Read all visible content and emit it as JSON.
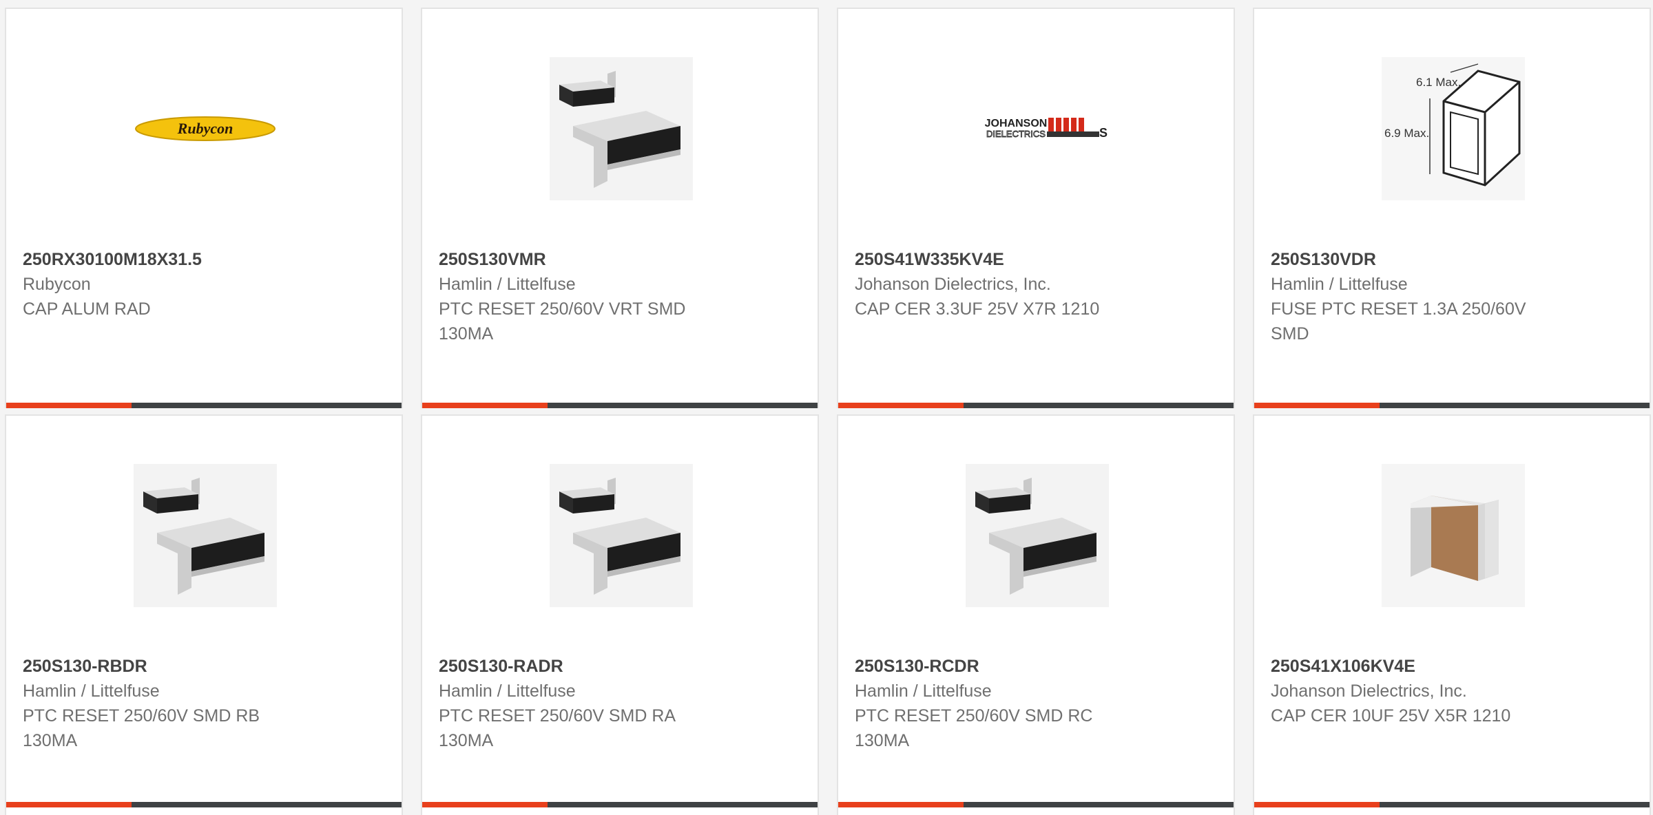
{
  "accent_color": "#e8401c",
  "bar_color": "#3f4244",
  "products": [
    {
      "part": "250RX30100M18X31.5",
      "manufacturer": "Rubycon",
      "description": "CAP ALUM RAD",
      "image": "rubycon-logo",
      "logo_text": "Rubycon"
    },
    {
      "part": "250S130VMR",
      "manufacturer": "Hamlin / Littelfuse",
      "description": "PTC RESET 250/60V VRT SMD 130MA",
      "image": "ptc-fuse-photo"
    },
    {
      "part": "250S41W335KV4E",
      "manufacturer": "Johanson Dielectrics, Inc.",
      "description": "CAP CER 3.3UF 25V X7R 1210",
      "image": "johanson-logo",
      "logo_text_1": "JOHANSON",
      "logo_text_2": "DIELECTRICS"
    },
    {
      "part": "250S130VDR",
      "manufacturer": "Hamlin / Littelfuse",
      "description": "FUSE PTC RESET 1.3A 250/60V SMD",
      "image": "fuse-dimension-drawing",
      "dim_1": "6.1 Max.",
      "dim_2": "6.9 Max."
    },
    {
      "part": "250S130-RBDR",
      "manufacturer": "Hamlin / Littelfuse",
      "description": "PTC RESET 250/60V SMD RB 130MA",
      "image": "ptc-fuse-photo"
    },
    {
      "part": "250S130-RADR",
      "manufacturer": "Hamlin / Littelfuse",
      "description": "PTC RESET 250/60V SMD RA 130MA",
      "image": "ptc-fuse-photo"
    },
    {
      "part": "250S130-RCDR",
      "manufacturer": "Hamlin / Littelfuse",
      "description": "PTC RESET 250/60V SMD RC 130MA",
      "image": "ptc-fuse-photo"
    },
    {
      "part": "250S41X106KV4E",
      "manufacturer": "Johanson Dielectrics, Inc.",
      "description": "CAP CER 10UF 25V X5R 1210",
      "image": "ceramic-capacitor-photo"
    }
  ]
}
